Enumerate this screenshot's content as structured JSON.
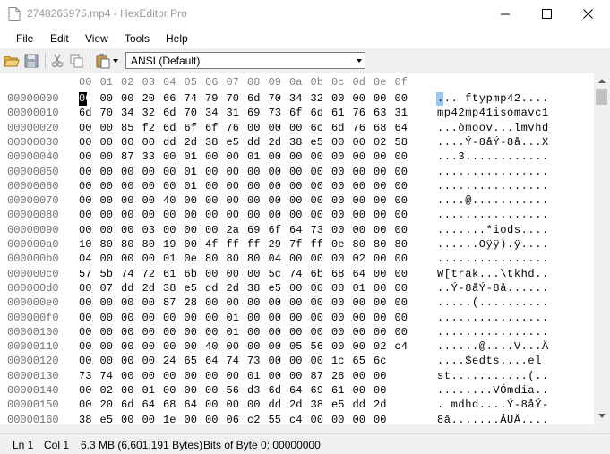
{
  "window": {
    "title": "2748265975.mp4 - HexEditor Pro",
    "controls": [
      "minimize-icon",
      "maximize-icon",
      "close-icon"
    ]
  },
  "menu": [
    "File",
    "Edit",
    "View",
    "Tools",
    "Help"
  ],
  "toolbar": {
    "icons": [
      "open-folder-icon",
      "save-icon",
      "cut-icon",
      "copy-icon",
      "paste-icon"
    ],
    "encoding": "ANSI (Default)"
  },
  "hex": {
    "header": [
      "00",
      "01",
      "02",
      "03",
      "04",
      "05",
      "06",
      "07",
      "08",
      "09",
      "0a",
      "0b",
      "0c",
      "0d",
      "0e",
      "0f"
    ],
    "rows": [
      {
        "offset": "00000000",
        "bytes": [
          "00",
          "00",
          "00",
          "20",
          "66",
          "74",
          "79",
          "70",
          "6d",
          "70",
          "34",
          "32",
          "00",
          "00",
          "00",
          "00"
        ],
        "ascii": "... ftypmp42...."
      },
      {
        "offset": "00000010",
        "bytes": [
          "6d",
          "70",
          "34",
          "32",
          "6d",
          "70",
          "34",
          "31",
          "69",
          "73",
          "6f",
          "6d",
          "61",
          "76",
          "63",
          "31"
        ],
        "ascii": "mp42mp41isomavc1"
      },
      {
        "offset": "00000020",
        "bytes": [
          "00",
          "00",
          "85",
          "f2",
          "6d",
          "6f",
          "6f",
          "76",
          "00",
          "00",
          "00",
          "6c",
          "6d",
          "76",
          "68",
          "64"
        ],
        "ascii": "...òmoov...lmvhd"
      },
      {
        "offset": "00000030",
        "bytes": [
          "00",
          "00",
          "00",
          "00",
          "dd",
          "2d",
          "38",
          "e5",
          "dd",
          "2d",
          "38",
          "e5",
          "00",
          "00",
          "02",
          "58"
        ],
        "ascii": "....Ý-8åÝ-8å...X"
      },
      {
        "offset": "00000040",
        "bytes": [
          "00",
          "00",
          "87",
          "33",
          "00",
          "01",
          "00",
          "00",
          "01",
          "00",
          "00",
          "00",
          "00",
          "00",
          "00",
          "00"
        ],
        "ascii": "...3............"
      },
      {
        "offset": "00000050",
        "bytes": [
          "00",
          "00",
          "00",
          "00",
          "00",
          "01",
          "00",
          "00",
          "00",
          "00",
          "00",
          "00",
          "00",
          "00",
          "00",
          "00"
        ],
        "ascii": "................"
      },
      {
        "offset": "00000060",
        "bytes": [
          "00",
          "00",
          "00",
          "00",
          "00",
          "01",
          "00",
          "00",
          "00",
          "00",
          "00",
          "00",
          "00",
          "00",
          "00",
          "00"
        ],
        "ascii": "................"
      },
      {
        "offset": "00000070",
        "bytes": [
          "00",
          "00",
          "00",
          "00",
          "40",
          "00",
          "00",
          "00",
          "00",
          "00",
          "00",
          "00",
          "00",
          "00",
          "00",
          "00"
        ],
        "ascii": "....@..........."
      },
      {
        "offset": "00000080",
        "bytes": [
          "00",
          "00",
          "00",
          "00",
          "00",
          "00",
          "00",
          "00",
          "00",
          "00",
          "00",
          "00",
          "00",
          "00",
          "00",
          "00"
        ],
        "ascii": "................"
      },
      {
        "offset": "00000090",
        "bytes": [
          "00",
          "00",
          "00",
          "03",
          "00",
          "00",
          "00",
          "2a",
          "69",
          "6f",
          "64",
          "73",
          "00",
          "00",
          "00",
          "00"
        ],
        "ascii": ".......*iods...."
      },
      {
        "offset": "000000a0",
        "bytes": [
          "10",
          "80",
          "80",
          "80",
          "19",
          "00",
          "4f",
          "ff",
          "ff",
          "29",
          "7f",
          "ff",
          "0e",
          "80",
          "80",
          "80"
        ],
        "ascii": "......Oÿÿ).ÿ...."
      },
      {
        "offset": "000000b0",
        "bytes": [
          "04",
          "00",
          "00",
          "00",
          "01",
          "0e",
          "80",
          "80",
          "80",
          "04",
          "00",
          "00",
          "00",
          "02",
          "00",
          "00"
        ],
        "ascii": "................"
      },
      {
        "offset": "000000c0",
        "bytes": [
          "57",
          "5b",
          "74",
          "72",
          "61",
          "6b",
          "00",
          "00",
          "00",
          "5c",
          "74",
          "6b",
          "68",
          "64",
          "00",
          "00"
        ],
        "ascii": "W[trak...\\tkhd.."
      },
      {
        "offset": "000000d0",
        "bytes": [
          "00",
          "07",
          "dd",
          "2d",
          "38",
          "e5",
          "dd",
          "2d",
          "38",
          "e5",
          "00",
          "00",
          "00",
          "01",
          "00",
          "00"
        ],
        "ascii": "..Ý-8åÝ-8å......"
      },
      {
        "offset": "000000e0",
        "bytes": [
          "00",
          "00",
          "00",
          "00",
          "87",
          "28",
          "00",
          "00",
          "00",
          "00",
          "00",
          "00",
          "00",
          "00",
          "00",
          "00"
        ],
        "ascii": ".....(.........."
      },
      {
        "offset": "000000f0",
        "bytes": [
          "00",
          "00",
          "00",
          "00",
          "00",
          "00",
          "00",
          "01",
          "00",
          "00",
          "00",
          "00",
          "00",
          "00",
          "00",
          "00"
        ],
        "ascii": "................"
      },
      {
        "offset": "00000100",
        "bytes": [
          "00",
          "00",
          "00",
          "00",
          "00",
          "00",
          "00",
          "01",
          "00",
          "00",
          "00",
          "00",
          "00",
          "00",
          "00",
          "00"
        ],
        "ascii": "................"
      },
      {
        "offset": "00000110",
        "bytes": [
          "00",
          "00",
          "00",
          "00",
          "00",
          "00",
          "40",
          "00",
          "00",
          "00",
          "05",
          "56",
          "00",
          "00",
          "02",
          "c4"
        ],
        "ascii": "......@....V...Ä"
      },
      {
        "offset": "00000120",
        "bytes": [
          "00",
          "00",
          "00",
          "00",
          "24",
          "65",
          "64",
          "74",
          "73",
          "00",
          "00",
          "00",
          "1c",
          "65",
          "6c",
          " "
        ],
        "ascii": "....$edts....el"
      },
      {
        "offset": "00000130",
        "bytes": [
          "73",
          "74",
          "00",
          "00",
          "00",
          "00",
          "00",
          "00",
          "01",
          "00",
          "00",
          "87",
          "28",
          "00",
          "00",
          " "
        ],
        "ascii": "st...........(.."
      },
      {
        "offset": "00000140",
        "bytes": [
          "00",
          "02",
          "00",
          "01",
          "00",
          "00",
          "00",
          "56",
          "d3",
          "6d",
          "64",
          "69",
          "61",
          "00",
          "00",
          " "
        ],
        "ascii": "........VÓmdia.."
      },
      {
        "offset": "00000150",
        "bytes": [
          "00",
          "20",
          "6d",
          "64",
          "68",
          "64",
          "00",
          "00",
          "00",
          "dd",
          "2d",
          "38",
          "e5",
          "dd",
          "2d",
          " "
        ],
        "ascii": ". mdhd....Ý-8åÝ-"
      },
      {
        "offset": "00000160",
        "bytes": [
          "38",
          "e5",
          "00",
          "00",
          "1e",
          "00",
          "00",
          "06",
          "c2",
          "55",
          "c4",
          "00",
          "00",
          "00",
          "00",
          " "
        ],
        "ascii": "8å.......ÂUÄ...."
      }
    ]
  },
  "status": {
    "line": "Ln 1",
    "col": "Col 1",
    "size": "6.3 MB (6,601,191 Bytes)",
    "bits": "Bits of Byte 0: 00000000"
  }
}
